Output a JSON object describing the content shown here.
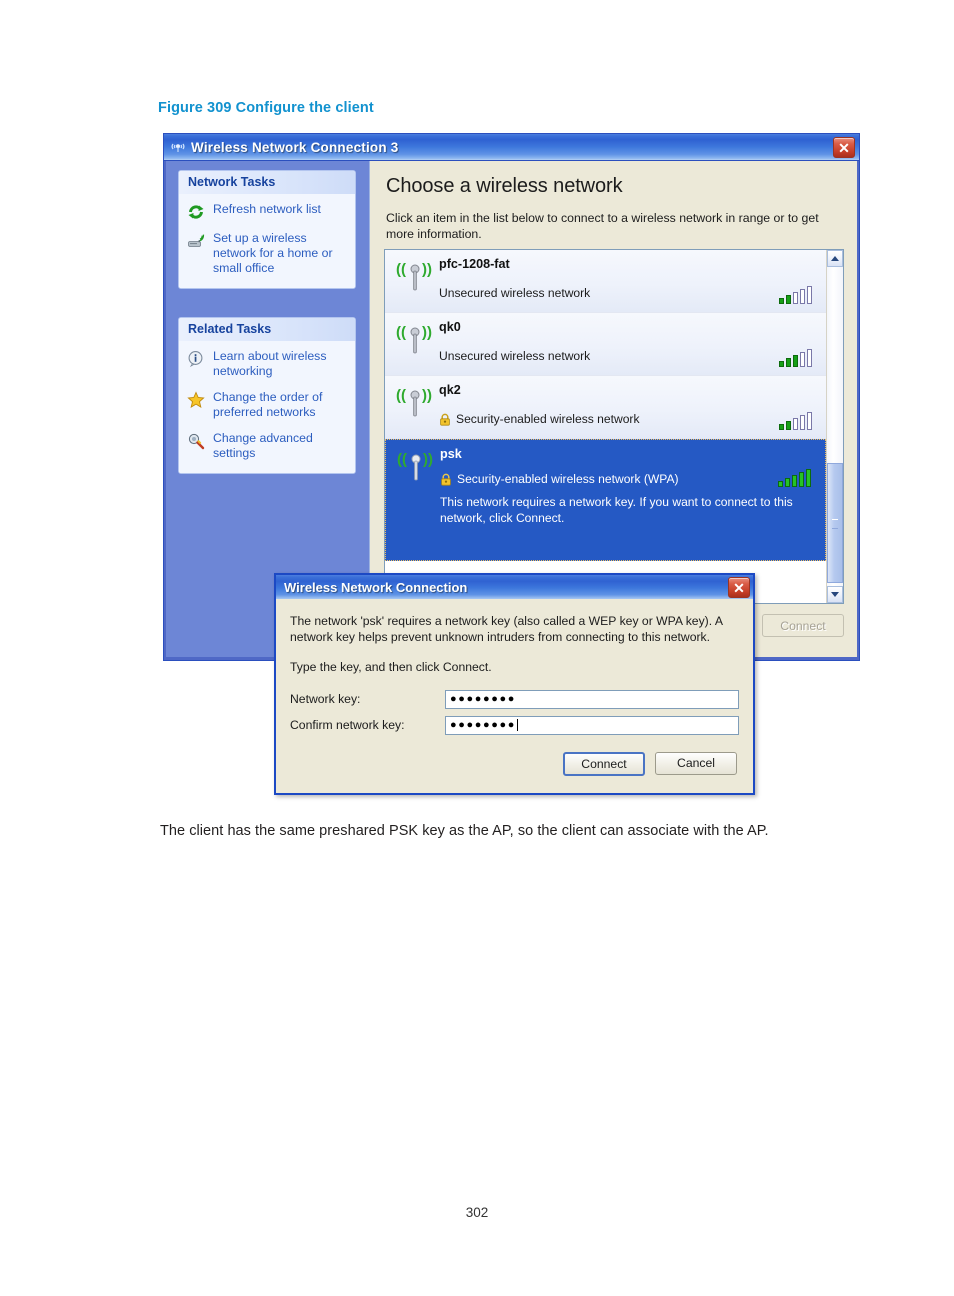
{
  "document": {
    "figure_caption": "Figure 309 Configure the client",
    "body_text": "The client has the same preshared PSK key as the AP, so the client can associate with the AP.",
    "page_number": "302"
  },
  "window": {
    "title": "Wireless Network Connection 3",
    "title_icon": "wireless-signal-icon",
    "close_label": "✕"
  },
  "sidebar": {
    "panels": [
      {
        "header": "Network Tasks",
        "items": [
          {
            "label": "Refresh network list",
            "icon": "refresh-icon"
          },
          {
            "label": "Set up a wireless network for a home or small office",
            "icon": "wireless-setup-icon"
          }
        ]
      },
      {
        "header": "Related Tasks",
        "items": [
          {
            "label": "Learn about wireless networking",
            "icon": "info-icon"
          },
          {
            "label": "Change the order of preferred networks",
            "icon": "star-icon"
          },
          {
            "label": "Change advanced settings",
            "icon": "advanced-settings-icon"
          }
        ]
      }
    ]
  },
  "main": {
    "heading": "Choose a wireless network",
    "description": "Click an item in the list below to connect to a wireless network in range or to get more information.",
    "connect_button": "Connect",
    "connect_button_enabled": false,
    "networks": [
      {
        "ssid": "pfc-1208-fat",
        "status": "Unsecured wireless network",
        "secured": false,
        "signal_bars": 2,
        "selected": false,
        "extra": ""
      },
      {
        "ssid": "qk0",
        "status": "Unsecured wireless network",
        "secured": false,
        "signal_bars": 3,
        "selected": false,
        "extra": ""
      },
      {
        "ssid": "qk2",
        "status": "Security-enabled wireless network",
        "secured": true,
        "signal_bars": 2,
        "selected": false,
        "extra": ""
      },
      {
        "ssid": "psk",
        "status": "Security-enabled wireless network (WPA)",
        "secured": true,
        "signal_bars": 5,
        "selected": true,
        "extra": "This network requires a network key. If you want to connect to this network, click Connect."
      }
    ]
  },
  "dialog": {
    "title": "Wireless Network Connection",
    "close_label": "✕",
    "paragraph1": "The network 'psk' requires a network key (also called a WEP key or WPA key). A network key helps prevent unknown intruders from connecting to this network.",
    "paragraph2": "Type the key, and then click Connect.",
    "network_key_label": "Network key:",
    "network_key_value": "●●●●●●●●",
    "confirm_key_label": "Confirm network key:",
    "confirm_key_value": "●●●●●●●●",
    "connect_label": "Connect",
    "cancel_label": "Cancel"
  },
  "colors": {
    "caption_blue": "#1292cf",
    "titlebar_blue": "#2f62d2",
    "sidebar_blue": "#6d86d6",
    "selection_blue": "#2559c4",
    "panel_bg": "#ece9d8",
    "signal_green": "#16a016"
  }
}
